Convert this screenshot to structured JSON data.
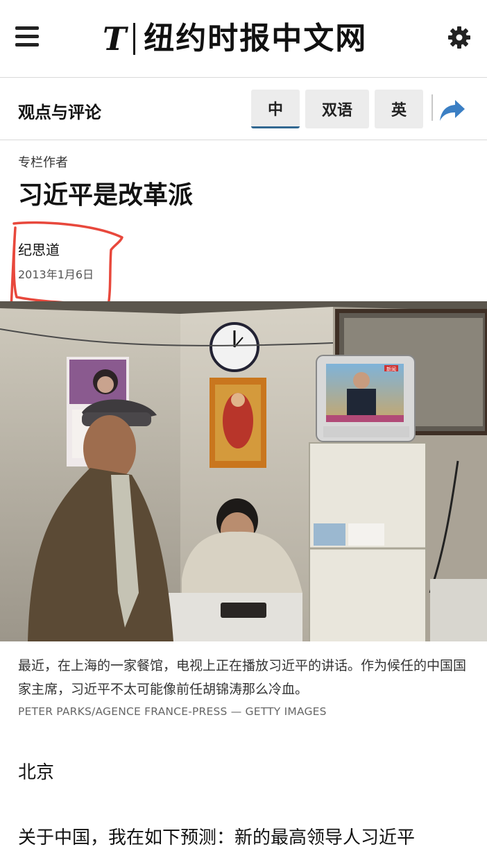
{
  "header": {
    "logo_glyph": "T",
    "title": "纽约时报中文网",
    "menu_icon": "hamburger-icon",
    "settings_icon": "gear-icon"
  },
  "section_bar": {
    "title": "观点与评论",
    "lang_tabs": [
      {
        "label": "中",
        "selected": true
      },
      {
        "label": "双语",
        "selected": false
      },
      {
        "label": "英",
        "selected": false
      }
    ],
    "share_icon": "share-arrow-icon",
    "accent_color": "#326891"
  },
  "article": {
    "kicker": "专栏作者",
    "headline": "习近平是改革派",
    "byline": "纪思道",
    "date": "2013年1月6日",
    "annotation_color": "#e8483c",
    "photo": {
      "tv_channel": "新闻"
    },
    "caption": "最近，在上海的一家餐馆，电视上正在播放习近平的讲话。作为候任的中国国家主席，习近平不太可能像前任胡锦涛那么冷血。",
    "credit": "PETER PARKS/AGENCE FRANCE-PRESS — GETTY IMAGES",
    "dateline": "北京",
    "first_paragraph": "关于中国，我在如下预测：新的最高领导人习近平"
  }
}
